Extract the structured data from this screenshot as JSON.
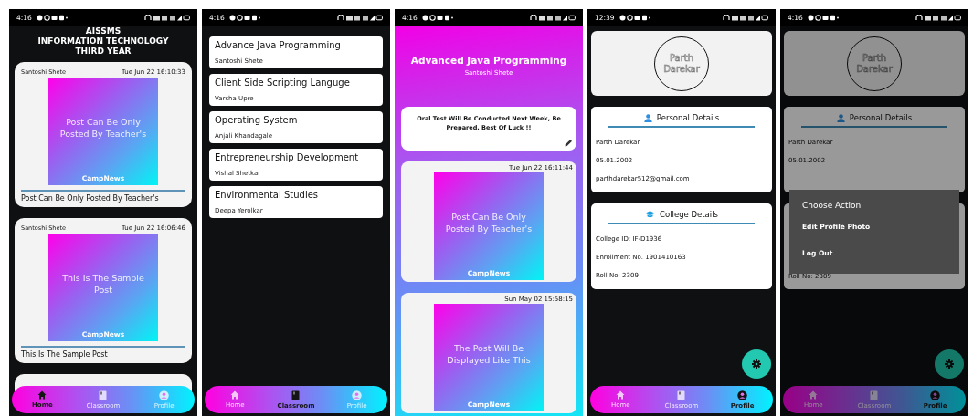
{
  "screens": [
    {
      "kind": "home",
      "status_time": "4:16",
      "header": [
        "AISSMS",
        "INFORMATION TECHNOLOGY",
        "THIRD YEAR"
      ],
      "posts": [
        {
          "author": "Santoshi Shete",
          "date": "Tue Jun 22 16:10:33",
          "image_text": "Post Can Be Only Posted By Teacher's",
          "image_brand": "CampNews",
          "caption": "Post Can Be Only Posted By Teacher's"
        },
        {
          "author": "Santoshi Shete",
          "date": "Tue Jun 22 16:06:46",
          "image_text": "This Is The Sample Post",
          "image_brand": "CampNews",
          "caption": "This Is The Sample Post"
        }
      ],
      "nav": [
        {
          "label": "Home",
          "selected": true
        },
        {
          "label": "Classroom",
          "selected": false
        },
        {
          "label": "Profile",
          "selected": false
        }
      ]
    },
    {
      "kind": "classroom",
      "status_time": "4:16",
      "courses": [
        {
          "title": "Advance Java Programming",
          "teacher": "Santoshi Shete"
        },
        {
          "title": "Client Side Scripting Languge",
          "teacher": "Varsha Upre"
        },
        {
          "title": "Operating System",
          "teacher": "Anjali Khandagale"
        },
        {
          "title": "Entrepreneurship Development",
          "teacher": "Vishal Shetkar"
        },
        {
          "title": "Environmental Studies",
          "teacher": "Deepa Yerolkar"
        }
      ],
      "nav": [
        {
          "label": "Home",
          "selected": false
        },
        {
          "label": "Classroom",
          "selected": true
        },
        {
          "label": "Profile",
          "selected": false
        }
      ]
    },
    {
      "kind": "course",
      "status_time": "4:16",
      "title": "Advanced Java Programming",
      "teacher": "Santoshi Shete",
      "announcement": "Oral Test Will Be Conducted Next Week, Be Prepared, Best Of Luck !!",
      "posts": [
        {
          "date": "Tue Jun 22 16:11:44",
          "image_text": "Post Can Be Only Posted By Teacher's",
          "image_brand": "CampNews"
        },
        {
          "date": "Sun May 02 15:58:15",
          "image_text": "The Post Will Be Displayed Like This",
          "image_brand": "CampNews"
        }
      ]
    },
    {
      "kind": "profile",
      "status_time": "12:39",
      "avatar_text": "Parth Darekar",
      "dimmed": false,
      "sections": [
        {
          "title": "Personal Details",
          "lines": [
            "Parth Darekar",
            "05.01.2002",
            "parthdarekar512@gmail.com"
          ]
        },
        {
          "title": "College Details",
          "lines": [
            "College ID: IF-D1936",
            "Enrollment No. 1901410163",
            "Roll No: 2309"
          ]
        }
      ],
      "nav": [
        {
          "label": "Home",
          "selected": false
        },
        {
          "label": "Classroom",
          "selected": false
        },
        {
          "label": "Profile",
          "selected": true
        }
      ]
    },
    {
      "kind": "profile",
      "status_time": "4:16",
      "avatar_text": "Parth Darekar",
      "dimmed": true,
      "sections": [
        {
          "title": "Personal Details",
          "lines": [
            "Parth Darekar",
            "05.01.2002"
          ]
        },
        {
          "lines": [
            "Roll No: 2309"
          ]
        }
      ],
      "dialog": {
        "title": "Choose Action",
        "actions": [
          "Edit Profile Photo",
          "Log Out"
        ]
      },
      "nav": [
        {
          "label": "Home",
          "selected": false
        },
        {
          "label": "Classroom",
          "selected": false
        },
        {
          "label": "Profile",
          "selected": true
        }
      ]
    }
  ]
}
